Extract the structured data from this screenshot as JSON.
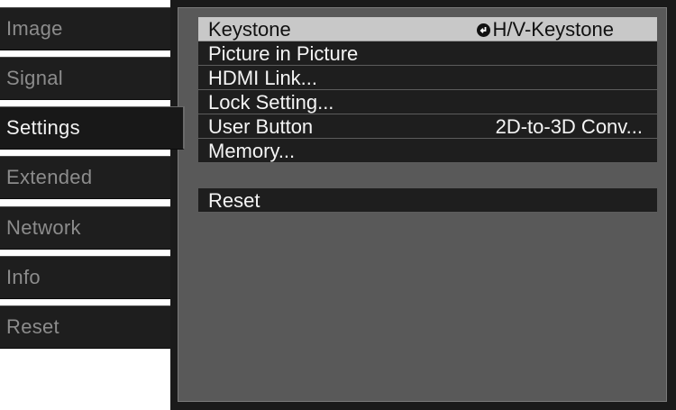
{
  "tabs": [
    {
      "label": "Image",
      "active": false
    },
    {
      "label": "Signal",
      "active": false
    },
    {
      "label": "Settings",
      "active": true
    },
    {
      "label": "Extended",
      "active": false
    },
    {
      "label": "Network",
      "active": false
    },
    {
      "label": "Info",
      "active": false
    },
    {
      "label": "Reset",
      "active": false
    }
  ],
  "menu": {
    "items": [
      {
        "label": "Keystone",
        "value": "H/V-Keystone",
        "value_icon": "enter-icon",
        "selected": true
      },
      {
        "label": "Picture in Picture",
        "value": ""
      },
      {
        "label": "HDMI Link...",
        "value": ""
      },
      {
        "label": "Lock Setting...",
        "value": ""
      },
      {
        "label": "User Button",
        "value": "2D-to-3D Conv..."
      },
      {
        "label": "Memory...",
        "value": ""
      }
    ],
    "reset_label": "Reset"
  },
  "colors": {
    "tab_bg": "#1e1e1e",
    "tab_inactive_text": "#8c8c8c",
    "tab_active_text": "#f2f2f2",
    "panel_bg": "#595959",
    "row_bg": "#1e1e1e",
    "row_selected_bg": "#c8c8c8"
  }
}
